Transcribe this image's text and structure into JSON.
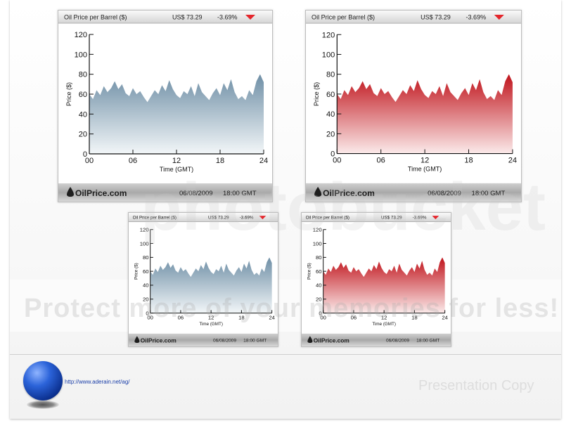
{
  "header": {
    "title": "Oil Price per Barrel ($)",
    "price": "US$ 73.29",
    "change": "-3.69%"
  },
  "footer": {
    "brand": "OilPrice.com",
    "date": "06/08/2009",
    "time": "18:00 GMT"
  },
  "colors": {
    "blue_fill_top": "#6f8fa6",
    "blue_fill_bottom": "#f2f6f8",
    "red_fill_top": "#c0141c",
    "red_fill_bottom": "#fbeaea",
    "arrow": "#e4262c",
    "globe": "#2b63d9",
    "url": "#1a3ea8"
  },
  "watermark": {
    "main": "Protect more of your memories for less!",
    "logo": "photobucket",
    "copy": "Presentation Copy"
  },
  "credit": {
    "url": "http://www.aderain.net/ag/",
    "icon": "globe-icon"
  },
  "chart_data": [
    {
      "type": "area",
      "color": "blue",
      "ylabel": "Price ($)",
      "xlabel": "Time (GMT)",
      "ylim": [
        0,
        120
      ],
      "xlim": [
        0,
        24
      ],
      "yticks": [
        0,
        20,
        40,
        60,
        80,
        100,
        120
      ],
      "xticks": [
        "00",
        "06",
        "12",
        "18",
        "24"
      ],
      "x": [
        0,
        0.5,
        1,
        1.5,
        2,
        2.5,
        3,
        3.5,
        4,
        4.5,
        5,
        5.5,
        6,
        6.5,
        7,
        7.5,
        8,
        8.5,
        9,
        9.5,
        10,
        10.5,
        11,
        11.5,
        12,
        12.5,
        13,
        13.5,
        14,
        14.5,
        15,
        15.5,
        16,
        16.5,
        17,
        17.5,
        18,
        18.5,
        19,
        19.5,
        20,
        20.5,
        21,
        21.5,
        22,
        22.5,
        23,
        23.5,
        24
      ],
      "values": [
        60,
        55,
        64,
        59,
        68,
        62,
        66,
        73,
        65,
        70,
        61,
        58,
        66,
        60,
        63,
        57,
        52,
        58,
        64,
        60,
        69,
        63,
        74,
        65,
        59,
        56,
        63,
        60,
        68,
        58,
        71,
        62,
        58,
        54,
        61,
        66,
        59,
        71,
        64,
        75,
        62,
        55,
        58,
        54,
        64,
        59,
        73,
        80,
        72
      ]
    },
    {
      "type": "area",
      "color": "red",
      "ylabel": "Price ($)",
      "xlabel": "Time (GMT)",
      "ylim": [
        0,
        120
      ],
      "xlim": [
        0,
        24
      ],
      "yticks": [
        0,
        20,
        40,
        60,
        80,
        100,
        120
      ],
      "xticks": [
        "00",
        "06",
        "12",
        "18",
        "24"
      ],
      "x": [
        0,
        0.5,
        1,
        1.5,
        2,
        2.5,
        3,
        3.5,
        4,
        4.5,
        5,
        5.5,
        6,
        6.5,
        7,
        7.5,
        8,
        8.5,
        9,
        9.5,
        10,
        10.5,
        11,
        11.5,
        12,
        12.5,
        13,
        13.5,
        14,
        14.5,
        15,
        15.5,
        16,
        16.5,
        17,
        17.5,
        18,
        18.5,
        19,
        19.5,
        20,
        20.5,
        21,
        21.5,
        22,
        22.5,
        23,
        23.5,
        24
      ],
      "values": [
        60,
        55,
        64,
        59,
        68,
        62,
        66,
        73,
        65,
        70,
        61,
        58,
        66,
        60,
        63,
        57,
        52,
        58,
        64,
        60,
        69,
        63,
        74,
        65,
        59,
        56,
        63,
        60,
        68,
        58,
        71,
        62,
        58,
        54,
        61,
        66,
        59,
        71,
        64,
        75,
        62,
        55,
        58,
        54,
        64,
        59,
        73,
        80,
        72
      ]
    },
    {
      "type": "area",
      "color": "blue",
      "ylabel": "Price ($)",
      "xlabel": "Time (GMT)",
      "ylim": [
        0,
        120
      ],
      "xlim": [
        0,
        24
      ],
      "yticks": [
        0,
        20,
        40,
        60,
        80,
        100,
        120
      ],
      "xticks": [
        "00",
        "06",
        "12",
        "18",
        "24"
      ],
      "x": [
        0,
        0.5,
        1,
        1.5,
        2,
        2.5,
        3,
        3.5,
        4,
        4.5,
        5,
        5.5,
        6,
        6.5,
        7,
        7.5,
        8,
        8.5,
        9,
        9.5,
        10,
        10.5,
        11,
        11.5,
        12,
        12.5,
        13,
        13.5,
        14,
        14.5,
        15,
        15.5,
        16,
        16.5,
        17,
        17.5,
        18,
        18.5,
        19,
        19.5,
        20,
        20.5,
        21,
        21.5,
        22,
        22.5,
        23,
        23.5,
        24
      ],
      "values": [
        60,
        55,
        64,
        59,
        68,
        62,
        66,
        73,
        65,
        70,
        61,
        58,
        66,
        60,
        63,
        57,
        52,
        58,
        64,
        60,
        69,
        63,
        74,
        65,
        59,
        56,
        63,
        60,
        68,
        58,
        71,
        62,
        58,
        54,
        61,
        66,
        59,
        71,
        64,
        75,
        62,
        55,
        58,
        54,
        64,
        59,
        73,
        80,
        72
      ]
    },
    {
      "type": "area",
      "color": "red",
      "ylabel": "Price ($)",
      "xlabel": "Time (GMT)",
      "ylim": [
        0,
        120
      ],
      "xlim": [
        0,
        24
      ],
      "yticks": [
        0,
        20,
        40,
        60,
        80,
        100,
        120
      ],
      "xticks": [
        "00",
        "06",
        "12",
        "18",
        "24"
      ],
      "x": [
        0,
        0.5,
        1,
        1.5,
        2,
        2.5,
        3,
        3.5,
        4,
        4.5,
        5,
        5.5,
        6,
        6.5,
        7,
        7.5,
        8,
        8.5,
        9,
        9.5,
        10,
        10.5,
        11,
        11.5,
        12,
        12.5,
        13,
        13.5,
        14,
        14.5,
        15,
        15.5,
        16,
        16.5,
        17,
        17.5,
        18,
        18.5,
        19,
        19.5,
        20,
        20.5,
        21,
        21.5,
        22,
        22.5,
        23,
        23.5,
        24
      ],
      "values": [
        60,
        55,
        64,
        59,
        68,
        62,
        66,
        73,
        65,
        70,
        61,
        58,
        66,
        60,
        63,
        57,
        52,
        58,
        64,
        60,
        69,
        63,
        74,
        65,
        59,
        56,
        63,
        60,
        68,
        58,
        71,
        62,
        58,
        54,
        61,
        66,
        59,
        71,
        64,
        75,
        62,
        55,
        58,
        54,
        64,
        59,
        73,
        80,
        72
      ]
    }
  ]
}
